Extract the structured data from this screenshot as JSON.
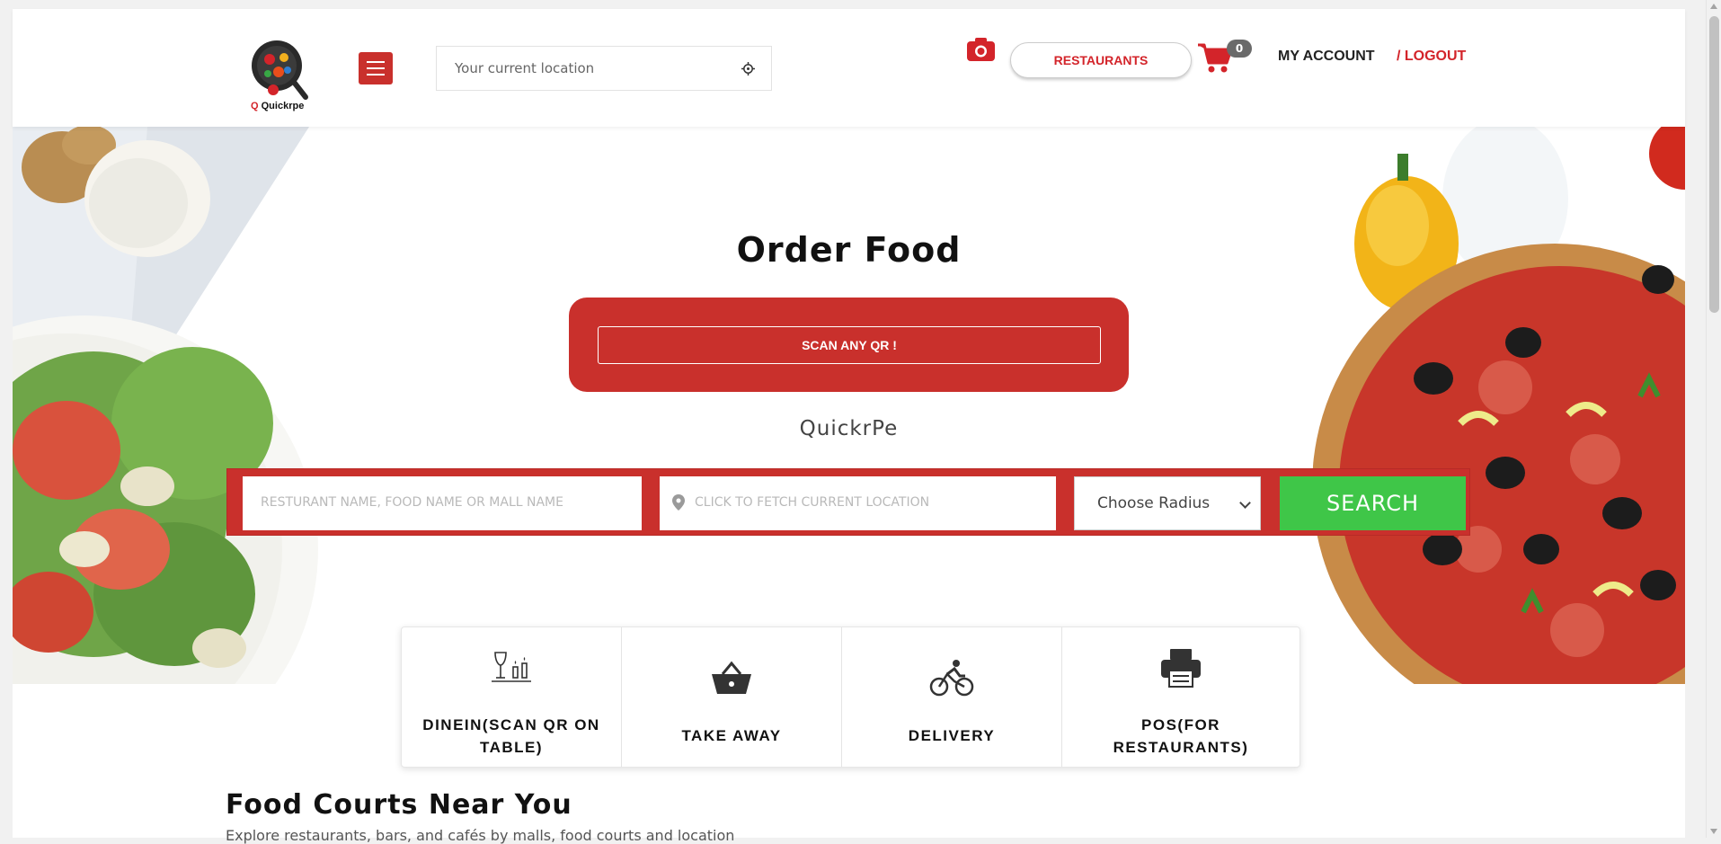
{
  "header": {
    "logo_text": "Quickrpe",
    "location_placeholder": "Your current location",
    "restaurants_label": "RESTAURANTS",
    "cart_count": "0",
    "my_account_label": "MY ACCOUNT",
    "logout_label": "/ LOGOUT"
  },
  "hero": {
    "title": "Order Food",
    "scan_label": "SCAN ANY QR !",
    "brand": "QuickrPe",
    "search": {
      "name_placeholder": "RESTURANT NAME, FOOD NAME OR MALL NAME",
      "location_placeholder": "CLICK TO FETCH CURRENT LOCATION",
      "radius_selected": "Choose Radius",
      "search_label": "SEARCH"
    }
  },
  "services": [
    {
      "label": "DINEIN(SCAN QR ON TABLE)",
      "icon": "dinein-icon"
    },
    {
      "label": "TAKE AWAY",
      "icon": "basket-icon"
    },
    {
      "label": "DELIVERY",
      "icon": "bicycle-icon"
    },
    {
      "label": "POS(FOR RESTAURANTS)",
      "icon": "printer-icon"
    }
  ],
  "food_courts": {
    "title": "Food Courts Near You",
    "subtitle": "Explore restaurants, bars, and cafés by malls, food courts and location"
  },
  "colors": {
    "brand_red": "#c9302c",
    "search_green": "#3fc648",
    "logout_red": "#d3242a"
  }
}
